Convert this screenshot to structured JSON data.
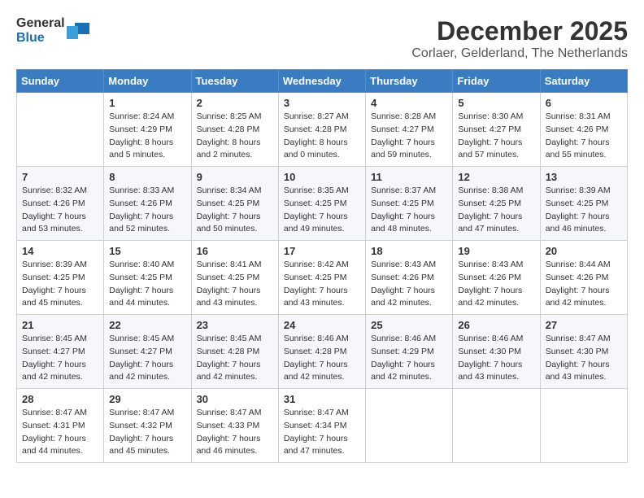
{
  "header": {
    "logo_general": "General",
    "logo_blue": "Blue",
    "title": "December 2025",
    "subtitle": "Corlaer, Gelderland, The Netherlands"
  },
  "calendar": {
    "days_of_week": [
      "Sunday",
      "Monday",
      "Tuesday",
      "Wednesday",
      "Thursday",
      "Friday",
      "Saturday"
    ],
    "weeks": [
      [
        {
          "day": "",
          "info": ""
        },
        {
          "day": "1",
          "info": "Sunrise: 8:24 AM\nSunset: 4:29 PM\nDaylight: 8 hours\nand 5 minutes."
        },
        {
          "day": "2",
          "info": "Sunrise: 8:25 AM\nSunset: 4:28 PM\nDaylight: 8 hours\nand 2 minutes."
        },
        {
          "day": "3",
          "info": "Sunrise: 8:27 AM\nSunset: 4:28 PM\nDaylight: 8 hours\nand 0 minutes."
        },
        {
          "day": "4",
          "info": "Sunrise: 8:28 AM\nSunset: 4:27 PM\nDaylight: 7 hours\nand 59 minutes."
        },
        {
          "day": "5",
          "info": "Sunrise: 8:30 AM\nSunset: 4:27 PM\nDaylight: 7 hours\nand 57 minutes."
        },
        {
          "day": "6",
          "info": "Sunrise: 8:31 AM\nSunset: 4:26 PM\nDaylight: 7 hours\nand 55 minutes."
        }
      ],
      [
        {
          "day": "7",
          "info": "Sunrise: 8:32 AM\nSunset: 4:26 PM\nDaylight: 7 hours\nand 53 minutes."
        },
        {
          "day": "8",
          "info": "Sunrise: 8:33 AM\nSunset: 4:26 PM\nDaylight: 7 hours\nand 52 minutes."
        },
        {
          "day": "9",
          "info": "Sunrise: 8:34 AM\nSunset: 4:25 PM\nDaylight: 7 hours\nand 50 minutes."
        },
        {
          "day": "10",
          "info": "Sunrise: 8:35 AM\nSunset: 4:25 PM\nDaylight: 7 hours\nand 49 minutes."
        },
        {
          "day": "11",
          "info": "Sunrise: 8:37 AM\nSunset: 4:25 PM\nDaylight: 7 hours\nand 48 minutes."
        },
        {
          "day": "12",
          "info": "Sunrise: 8:38 AM\nSunset: 4:25 PM\nDaylight: 7 hours\nand 47 minutes."
        },
        {
          "day": "13",
          "info": "Sunrise: 8:39 AM\nSunset: 4:25 PM\nDaylight: 7 hours\nand 46 minutes."
        }
      ],
      [
        {
          "day": "14",
          "info": "Sunrise: 8:39 AM\nSunset: 4:25 PM\nDaylight: 7 hours\nand 45 minutes."
        },
        {
          "day": "15",
          "info": "Sunrise: 8:40 AM\nSunset: 4:25 PM\nDaylight: 7 hours\nand 44 minutes."
        },
        {
          "day": "16",
          "info": "Sunrise: 8:41 AM\nSunset: 4:25 PM\nDaylight: 7 hours\nand 43 minutes."
        },
        {
          "day": "17",
          "info": "Sunrise: 8:42 AM\nSunset: 4:25 PM\nDaylight: 7 hours\nand 43 minutes."
        },
        {
          "day": "18",
          "info": "Sunrise: 8:43 AM\nSunset: 4:26 PM\nDaylight: 7 hours\nand 42 minutes."
        },
        {
          "day": "19",
          "info": "Sunrise: 8:43 AM\nSunset: 4:26 PM\nDaylight: 7 hours\nand 42 minutes."
        },
        {
          "day": "20",
          "info": "Sunrise: 8:44 AM\nSunset: 4:26 PM\nDaylight: 7 hours\nand 42 minutes."
        }
      ],
      [
        {
          "day": "21",
          "info": "Sunrise: 8:45 AM\nSunset: 4:27 PM\nDaylight: 7 hours\nand 42 minutes."
        },
        {
          "day": "22",
          "info": "Sunrise: 8:45 AM\nSunset: 4:27 PM\nDaylight: 7 hours\nand 42 minutes."
        },
        {
          "day": "23",
          "info": "Sunrise: 8:45 AM\nSunset: 4:28 PM\nDaylight: 7 hours\nand 42 minutes."
        },
        {
          "day": "24",
          "info": "Sunrise: 8:46 AM\nSunset: 4:28 PM\nDaylight: 7 hours\nand 42 minutes."
        },
        {
          "day": "25",
          "info": "Sunrise: 8:46 AM\nSunset: 4:29 PM\nDaylight: 7 hours\nand 42 minutes."
        },
        {
          "day": "26",
          "info": "Sunrise: 8:46 AM\nSunset: 4:30 PM\nDaylight: 7 hours\nand 43 minutes."
        },
        {
          "day": "27",
          "info": "Sunrise: 8:47 AM\nSunset: 4:30 PM\nDaylight: 7 hours\nand 43 minutes."
        }
      ],
      [
        {
          "day": "28",
          "info": "Sunrise: 8:47 AM\nSunset: 4:31 PM\nDaylight: 7 hours\nand 44 minutes."
        },
        {
          "day": "29",
          "info": "Sunrise: 8:47 AM\nSunset: 4:32 PM\nDaylight: 7 hours\nand 45 minutes."
        },
        {
          "day": "30",
          "info": "Sunrise: 8:47 AM\nSunset: 4:33 PM\nDaylight: 7 hours\nand 46 minutes."
        },
        {
          "day": "31",
          "info": "Sunrise: 8:47 AM\nSunset: 4:34 PM\nDaylight: 7 hours\nand 47 minutes."
        },
        {
          "day": "",
          "info": ""
        },
        {
          "day": "",
          "info": ""
        },
        {
          "day": "",
          "info": ""
        }
      ]
    ]
  }
}
